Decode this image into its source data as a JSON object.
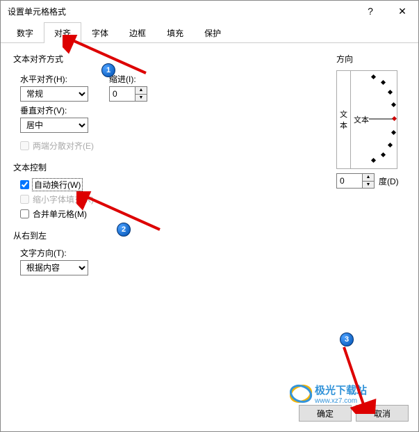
{
  "window": {
    "title": "设置单元格格式",
    "help": "?",
    "close": "✕"
  },
  "tabs": {
    "number": "数字",
    "alignment": "对齐",
    "font": "字体",
    "border": "边框",
    "fill": "填充",
    "protection": "保护"
  },
  "alignment": {
    "section": "文本对齐方式",
    "horiz_label": "水平对齐(H):",
    "horiz_value": "常规",
    "indent_label": "缩进(I):",
    "indent_value": "0",
    "vert_label": "垂直对齐(V):",
    "vert_value": "居中",
    "justify": "两端分散对齐(E)"
  },
  "textcontrol": {
    "section": "文本控制",
    "wrap": "自动换行(W)",
    "shrink": "缩小字体填充(K)",
    "merge": "合并单元格(M)"
  },
  "rtl": {
    "section": "从右到左",
    "dir_label": "文字方向(T):",
    "dir_value": "根据内容"
  },
  "orientation": {
    "section": "方向",
    "vtext1": "文",
    "vtext2": "本",
    "htext": "文本",
    "degree_value": "0",
    "degree_label": "度(D)"
  },
  "buttons": {
    "ok": "确定",
    "cancel": "取消"
  },
  "badges": {
    "b1": "1",
    "b2": "2",
    "b3": "3"
  },
  "watermark": {
    "text": "极光下载站",
    "url": "www.xz7.com"
  }
}
